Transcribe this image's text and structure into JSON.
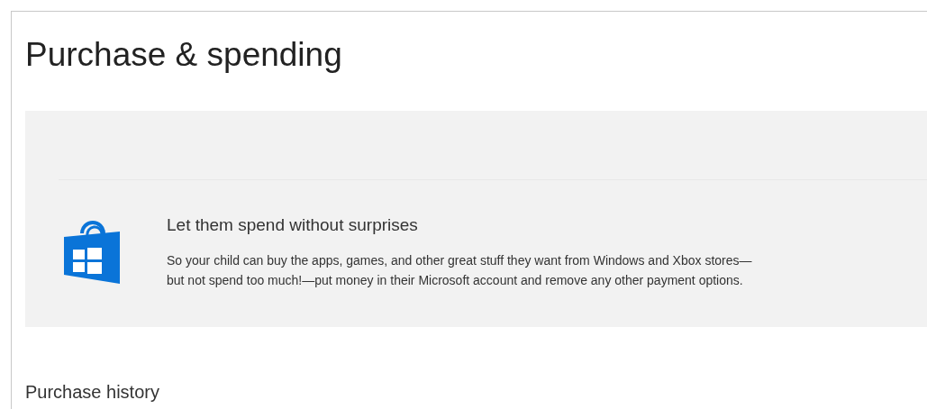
{
  "page": {
    "title": "Purchase & spending"
  },
  "banner": {
    "heading": "Let them spend without surprises",
    "body_lines": [
      "So your child can buy the apps, games, and other great stuff they want from Windows and Xbox stores—",
      "but not spend too much!—put money in their Microsoft account and remove any other payment options."
    ]
  },
  "section": {
    "title": "Purchase history"
  }
}
